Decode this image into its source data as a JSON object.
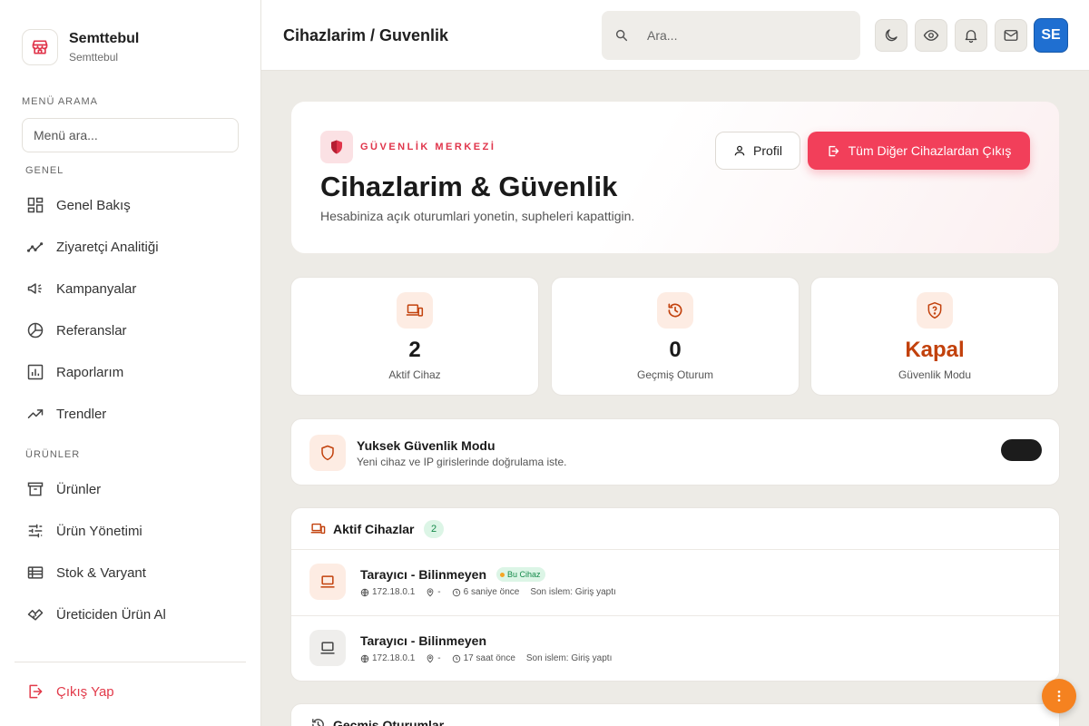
{
  "brand": {
    "name": "Semttebul",
    "subtitle": "Semttebul"
  },
  "sidebar": {
    "search_label": "MENÜ ARAMA",
    "search_placeholder": "Menü ara...",
    "sections": [
      {
        "label": "GENEL",
        "items": [
          "Genel Bakış",
          "Ziyaretçi Analitiği",
          "Kampanyalar",
          "Referanslar",
          "Raporlarım",
          "Trendler"
        ]
      },
      {
        "label": "ÜRÜNLER",
        "items": [
          "Ürünler",
          "Ürün Yönetimi",
          "Stok & Varyant",
          "Üreticiden Ürün Al"
        ]
      }
    ],
    "logout": "Çıkış Yap"
  },
  "topbar": {
    "breadcrumb": "Cihazlarim / Guvenlik",
    "search_placeholder": "Ara...",
    "avatar_initials": "SE"
  },
  "hero": {
    "kicker": "GÜVENLİK MERKEZİ",
    "title": "Cihazlarim & Güvenlik",
    "subtitle": "Hesabiniza açık oturumlari yonetin, supheleri kapattigin.",
    "profile_button": "Profil",
    "logout_all_button": "Tüm Diğer Cihazlardan Çıkış"
  },
  "stats": [
    {
      "value": "2",
      "label": "Aktif Cihaz"
    },
    {
      "value": "0",
      "label": "Geçmiş Oturum"
    },
    {
      "value": "Kapal",
      "label": "Güvenlik Modu"
    }
  ],
  "high_security": {
    "title": "Yuksek Güvenlik Modu",
    "subtitle": "Yeni cihaz ve IP girislerinde doğrulama iste.",
    "enabled": false
  },
  "active_devices": {
    "title": "Aktif Cihazlar",
    "count": "2",
    "devices": [
      {
        "name": "Tarayıcı - Bilinmeyen",
        "badge": "Bu Cihaz",
        "ip": "172.18.0.1",
        "location": "-",
        "time": "6 saniye önce",
        "last_action": "Son islem: Giriş yaptı"
      },
      {
        "name": "Tarayıcı - Bilinmeyen",
        "ip": "172.18.0.1",
        "location": "-",
        "time": "17 saat önce",
        "last_action": "Son islem: Giriş yaptı"
      }
    ]
  },
  "past_sessions": {
    "title": "Geçmiş Oturumlar"
  },
  "colors": {
    "accent": "#f23f5a",
    "orange": "#c2410c",
    "logout": "#e23a4a",
    "avatar": "#1f6fd1"
  }
}
